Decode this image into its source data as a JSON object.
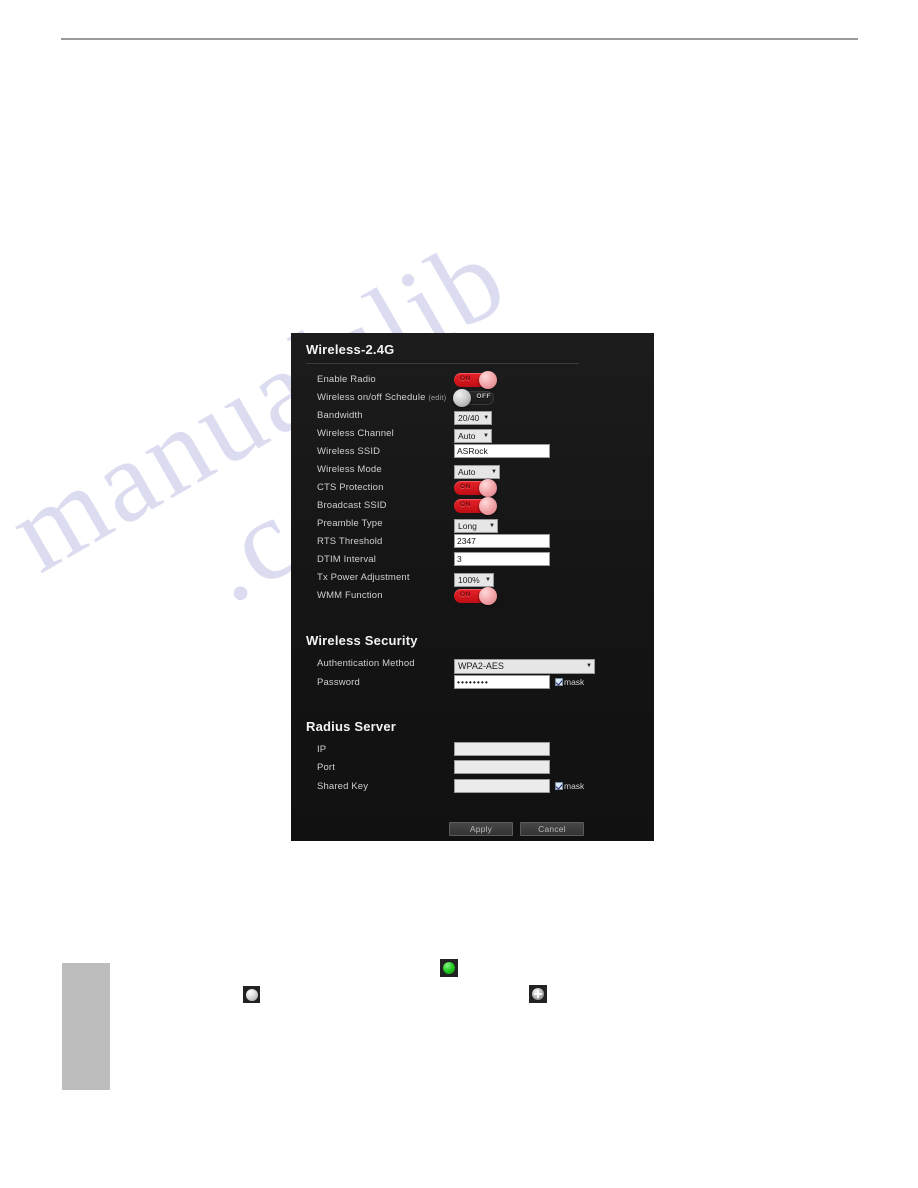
{
  "page": {
    "rule_present": true,
    "side_tab_present": true,
    "watermark_line1": "manualslib",
    "watermark_line2": ".com"
  },
  "panel": {
    "title": "Wireless-2.4G",
    "rows": [
      {
        "label": "Enable Radio",
        "control": "toggle",
        "state": "ON"
      },
      {
        "label": "Wireless on/off Schedule",
        "suffix": "(edit)",
        "control": "toggle",
        "state": "OFF"
      },
      {
        "label": "Bandwidth",
        "control": "select",
        "value": "20/40"
      },
      {
        "label": "Wireless Channel",
        "control": "select",
        "value": "Auto"
      },
      {
        "label": "Wireless SSID",
        "control": "text",
        "value": "ASRock"
      },
      {
        "label": "Wireless Mode",
        "control": "select",
        "value": "Auto"
      },
      {
        "label": "CTS Protection",
        "control": "toggle",
        "state": "ON"
      },
      {
        "label": "Broadcast SSID",
        "control": "toggle",
        "state": "ON"
      },
      {
        "label": "Preamble Type",
        "control": "select",
        "value": "Long"
      },
      {
        "label": "RTS Threshold",
        "control": "text",
        "value": "2347"
      },
      {
        "label": "DTIM Interval",
        "control": "text",
        "value": "3"
      },
      {
        "label": "Tx Power Adjustment",
        "control": "select",
        "value": "100%"
      },
      {
        "label": "WMM Function",
        "control": "toggle",
        "state": "ON"
      }
    ]
  },
  "security": {
    "title": "Wireless Security",
    "auth_label": "Authentication Method",
    "auth_value": "WPA2-AES",
    "password_label": "Password",
    "password_value": "••••••••",
    "mask_label": "mask"
  },
  "radius": {
    "title": "Radius Server",
    "ip_label": "IP",
    "ip_value": "",
    "port_label": "Port",
    "port_value": "",
    "shared_key_label": "Shared Key",
    "shared_key_value": "",
    "mask_label": "mask"
  },
  "actions": {
    "apply_label": "Apply",
    "cancel_label": "Cancel"
  },
  "colors": {
    "toggle_on": "#d21017",
    "panel_bg": "#161616",
    "accent_text": "#f2f2f5",
    "status_green": "#22cc22"
  }
}
